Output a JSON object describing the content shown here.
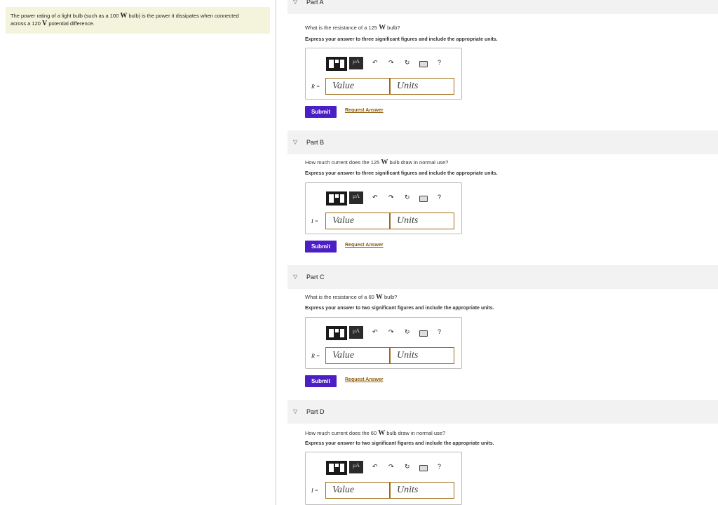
{
  "problem": {
    "text_before_power": "The power rating of a light bulb (such as a 100",
    "unit_w": "W",
    "text_after_power": "bulb) is the power it dissipates when connected",
    "text_line2_before": "across a 120",
    "unit_v": "V",
    "text_line2_after": "potential difference."
  },
  "toolbar": {
    "mu_label": "μA",
    "undo": "↶",
    "redo": "↷",
    "reset": "↻",
    "help": "?"
  },
  "parts": [
    {
      "title": "Part A",
      "question_before": "What is the resistance of a 125",
      "question_unit": "W",
      "question_after": "bulb?",
      "instruction": "Express your answer to three significant figures and include the appropriate units.",
      "variable": "R =",
      "value_placeholder": "Value",
      "units_placeholder": "Units",
      "submit": "Submit",
      "request": "Request Answer"
    },
    {
      "title": "Part B",
      "question_before": "How much current does the 125",
      "question_unit": "W",
      "question_after": "bulb draw in normal use?",
      "instruction": "Express your answer to three significant figures and include the appropriate units.",
      "variable": "I =",
      "value_placeholder": "Value",
      "units_placeholder": "Units",
      "submit": "Submit",
      "request": "Request Answer"
    },
    {
      "title": "Part C",
      "question_before": "What is the resistance of a 60",
      "question_unit": "W",
      "question_after": "bulb?",
      "instruction": "Express your answer to two significant figures and include the appropriate units.",
      "variable": "R =",
      "value_placeholder": "Value",
      "units_placeholder": "Units",
      "submit": "Submit",
      "request": "Request Answer"
    },
    {
      "title": "Part D",
      "question_before": "How much current does the 60",
      "question_unit": "W",
      "question_after": "bulb draw in normal use?",
      "instruction": "Express your answer to two significant figures and include the appropriate units.",
      "variable": "I =",
      "value_placeholder": "Value",
      "units_placeholder": "Units"
    }
  ]
}
